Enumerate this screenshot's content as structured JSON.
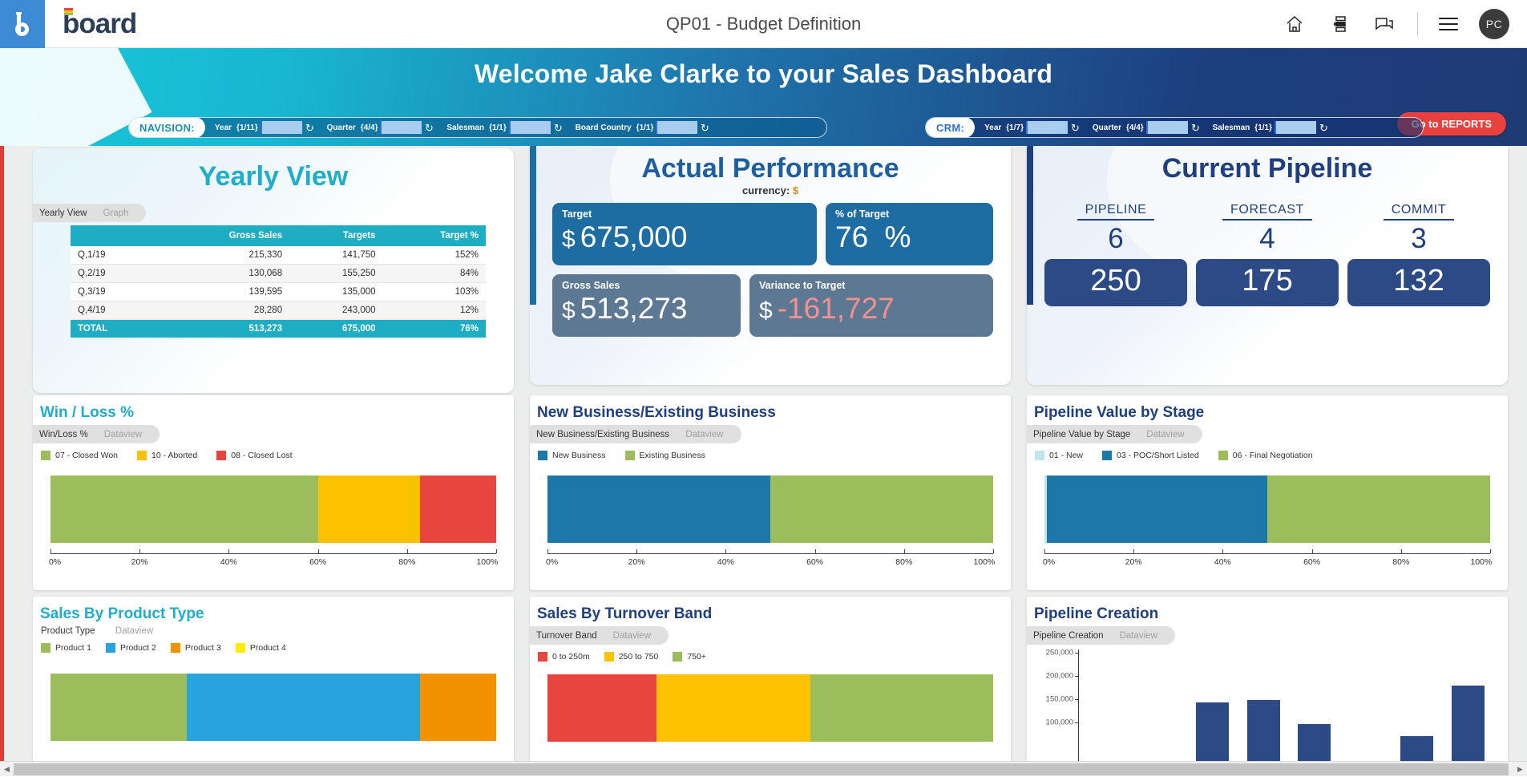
{
  "topbar": {
    "title": "QP01 - Budget Definition",
    "logo_text": "board",
    "icons": [
      "home-icon",
      "layout-icon",
      "chat-icon",
      "menu-icon"
    ],
    "avatar_initials": "PC"
  },
  "banner": {
    "greeting_prefix": "Welcome",
    "user_name": "Jake Clarke",
    "greeting_suffix": "to your Sales Dashboard",
    "reports_button": "Go to REPORTS",
    "selectors": [
      {
        "name": "NAVISION:",
        "filters": [
          {
            "label": "Year",
            "count": "{1/11}"
          },
          {
            "label": "Quarter",
            "count": "{4/4}"
          },
          {
            "label": "Salesman",
            "count": "{1/1}"
          },
          {
            "label": "Board Country",
            "count": "{1/1}"
          }
        ]
      },
      {
        "name": "CRM:",
        "filters": [
          {
            "label": "Year",
            "count": "{1/7}"
          },
          {
            "label": "Quarter",
            "count": "{4/4}"
          },
          {
            "label": "Salesman",
            "count": "{1/1}"
          }
        ]
      }
    ]
  },
  "yearly_view": {
    "title": "Yearly View",
    "tab_active": "Yearly View",
    "tab_inactive": "Graph",
    "columns": [
      "",
      "Gross Sales",
      "Targets",
      "Target %"
    ],
    "rows": [
      {
        "period": "Q,1/19",
        "gross_sales": "215,330",
        "targets": "141,750",
        "target_pct": "152%"
      },
      {
        "period": "Q,2/19",
        "gross_sales": "130,068",
        "targets": "155,250",
        "target_pct": "84%"
      },
      {
        "period": "Q,3/19",
        "gross_sales": "139,595",
        "targets": "135,000",
        "target_pct": "103%"
      },
      {
        "period": "Q,4/19",
        "gross_sales": "28,280",
        "targets": "243,000",
        "target_pct": "12%"
      }
    ],
    "total": {
      "period": "TOTAL",
      "gross_sales": "513,273",
      "targets": "675,000",
      "target_pct": "76%"
    }
  },
  "actual_performance": {
    "title": "Actual Performance",
    "currency_label": "currency:",
    "currency_symbol": "$",
    "target": {
      "label": "Target",
      "symbol": "$",
      "value": "675,000"
    },
    "pct_of_target": {
      "label": "% of Target",
      "value": "76",
      "unit": "%"
    },
    "gross_sales": {
      "label": "Gross Sales",
      "symbol": "$",
      "value": "513,273"
    },
    "variance": {
      "label": "Variance to Target",
      "symbol": "$",
      "value": "-161,727"
    }
  },
  "current_pipeline": {
    "title": "Current Pipeline",
    "columns": [
      {
        "head": "PIPELINE",
        "count": "6",
        "value": "250"
      },
      {
        "head": "FORECAST",
        "count": "4",
        "value": "175"
      },
      {
        "head": "COMMIT",
        "count": "3",
        "value": "132"
      }
    ]
  },
  "colors": {
    "cyan": "#21acca",
    "navy": "#1f3f7e",
    "blue": "#1f5fa0",
    "red": "#e8413e",
    "green": "#9bbd5c",
    "yellow": "#fcc200",
    "tile_blue": "#2c4a85",
    "steel": "#5c7893"
  },
  "chart_data": [
    {
      "type": "bar",
      "orientation": "horizontal-stacked",
      "title": "Win / Loss %",
      "tab_active": "Win/Loss %",
      "tab_inactive": "Dataview",
      "categories": [
        "07 - Closed Won",
        "10 - Aborted",
        "08 - Closed Lost"
      ],
      "values": [
        60,
        23,
        17
      ],
      "colors": [
        "#9bbd5c",
        "#fcc200",
        "#e8453f"
      ],
      "xlabel": "",
      "ylabel": "",
      "xlim": [
        0,
        100
      ],
      "ticks": [
        "0%",
        "20%",
        "40%",
        "60%",
        "80%",
        "100%"
      ],
      "legend": "top"
    },
    {
      "type": "bar",
      "orientation": "horizontal-stacked",
      "title": "New Business/Existing Business",
      "tab_active": "New Business/Existing Business",
      "tab_inactive": "Dataview",
      "categories": [
        "New Business",
        "Existing Business"
      ],
      "values": [
        50,
        50
      ],
      "colors": [
        "#1d77a8",
        "#9bbd5c"
      ],
      "xlabel": "",
      "ylabel": "",
      "xlim": [
        0,
        100
      ],
      "ticks": [
        "0%",
        "20%",
        "40%",
        "60%",
        "80%",
        "100%"
      ],
      "legend": "top"
    },
    {
      "type": "bar",
      "orientation": "horizontal-stacked",
      "title": "Pipeline Value by Stage",
      "tab_active": "Pipeline Value by Stage",
      "tab_inactive": "Dataview",
      "categories": [
        "01 - New",
        "03 - POC/Short Listed",
        "06 - Final Negotiation"
      ],
      "values": [
        0.6,
        49.4,
        50
      ],
      "colors": [
        "#bfe6ea",
        "#1d77a8",
        "#9bbd5c"
      ],
      "xlabel": "",
      "ylabel": "",
      "xlim": [
        0,
        100
      ],
      "ticks": [
        "0%",
        "20%",
        "40%",
        "60%",
        "80%",
        "100%"
      ],
      "legend": "top"
    },
    {
      "type": "bar",
      "orientation": "horizontal-stacked",
      "title": "Sales By Product Type",
      "tab_active": "Product Type",
      "tab_inactive": "Dataview",
      "categories": [
        "Product 1",
        "Product 2",
        "Product 3",
        "Product 4"
      ],
      "values": [
        30.5,
        52.5,
        17,
        0
      ],
      "colors": [
        "#9bbd5c",
        "#29a3dc",
        "#f39200",
        "#ffee00"
      ],
      "xlabel": "",
      "ylabel": "",
      "xlim": [
        0,
        100
      ],
      "legend": "top"
    },
    {
      "type": "bar",
      "orientation": "horizontal-stacked",
      "title": "Sales By Turnover Band",
      "tab_active": "Turnover Band",
      "tab_inactive": "Dataview",
      "categories": [
        "0 to 250m",
        "250 to 750",
        "750+"
      ],
      "values": [
        24.5,
        34.5,
        41
      ],
      "colors": [
        "#e8453f",
        "#fcc200",
        "#9bbd5c"
      ],
      "xlabel": "",
      "ylabel": "",
      "xlim": [
        0,
        100
      ],
      "legend": "top"
    },
    {
      "type": "bar",
      "orientation": "vertical",
      "title": "Pipeline Creation",
      "tab_active": "Pipeline Creation",
      "tab_inactive": "Dataview",
      "categories": [
        "",
        "",
        "",
        "",
        "",
        "",
        "",
        ""
      ],
      "values": [
        0,
        0,
        165000,
        170000,
        112000,
        0,
        82000,
        205000
      ],
      "color": "#2c4a85",
      "ylim": [
        0,
        250000
      ],
      "yticks": [
        "250,000",
        "200,000",
        "150,000",
        "100,000"
      ],
      "xlabel": "",
      "ylabel": ""
    }
  ]
}
